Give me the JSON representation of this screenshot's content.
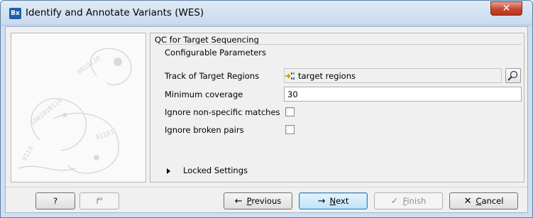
{
  "window": {
    "title": "Identify and Annotate Variants (WES)",
    "app_icon_text": "Bx",
    "close_glyph": "✕"
  },
  "section": {
    "title": "QC for Target Sequencing",
    "group_title": "Configurable Parameters"
  },
  "params": {
    "track_label": "Track of Target Regions",
    "track_value": "target regions",
    "min_cov_label": "Minimum coverage",
    "min_cov_value": "30",
    "ignore_nonspecific_label": "Ignore non-specific matches",
    "ignore_nonspecific_checked": false,
    "ignore_broken_label": "Ignore broken pairs",
    "ignore_broken_checked": false
  },
  "locked": {
    "label": "Locked Settings"
  },
  "buttons": {
    "help": "?",
    "previous_glyph": "←",
    "previous_pre": "",
    "previous_ul": "P",
    "previous_post": "revious",
    "next_glyph": "→",
    "next_pre": "",
    "next_ul": "N",
    "next_post": "ext",
    "finish_glyph": "✓",
    "finish_pre": "",
    "finish_ul": "F",
    "finish_post": "inish",
    "cancel_glyph": "✕",
    "cancel_pre": "",
    "cancel_ul": "C",
    "cancel_post": "ancel"
  },
  "icons": {
    "app": "app-logo-icon",
    "track": "track-icon",
    "browse": "browse-icon",
    "reset": "reset-icon"
  },
  "colors": {
    "accent": "#3c7fb1",
    "title_bar": "#c9daee",
    "close": "#c9452e"
  }
}
